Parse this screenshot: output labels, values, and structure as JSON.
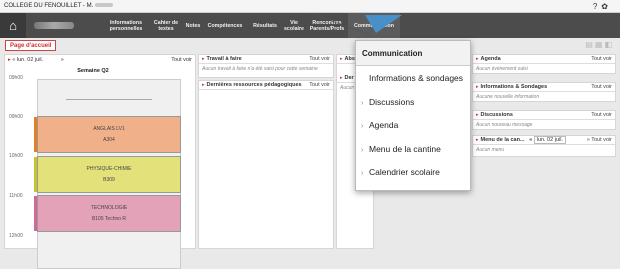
{
  "window": {
    "title": "COLLEGE DU FENOUILLET - M."
  },
  "nav": {
    "items": [
      {
        "label": "Informations personnelles"
      },
      {
        "label": "Cahier de textes"
      },
      {
        "label": "Notes"
      },
      {
        "label": "Compétences"
      },
      {
        "label": "Résultats"
      },
      {
        "label": "Vie scolaire"
      },
      {
        "label": "Rencontres Parents/Profs"
      },
      {
        "label": "Communication"
      }
    ]
  },
  "page_tab": "Page d'accueil",
  "agenda": {
    "nav_date": "lun. 02 juil.",
    "more": "Tout voir",
    "week": "Semaine Q2",
    "hours": [
      "09h00",
      "10h00",
      "11h00",
      "12h00"
    ],
    "hours_b": [
      "09h00",
      "10h00",
      "11h00",
      "12h00"
    ],
    "courses": [
      {
        "name": "ANGLAIS LV1",
        "room": "A304",
        "color": "#f0b08a",
        "bar": "#e67e22"
      },
      {
        "name": "PHYSIQUE-CHIMIE",
        "room": "B309",
        "color": "#e3e27a",
        "bar": "#c8c430"
      },
      {
        "name": "TECHNOLOGIE",
        "room": "B105 Techno R",
        "color": "#e3a2b8",
        "bar": "#d2679a"
      }
    ]
  },
  "travail": {
    "title": "Travail à faire",
    "more": "Tout voir",
    "empty": "Aucun travail à faire n'a été saisi pour cette semaine"
  },
  "ressources": {
    "title": "Dernières ressources pédagogiques",
    "more": "Tout voir"
  },
  "abs": {
    "title": "Abs",
    "label2": "Der",
    "text": "Aucun"
  },
  "right": {
    "agenda": {
      "title": "Agenda",
      "more": "Tout voir",
      "empty": "Aucun évènement saisi"
    },
    "infos": {
      "title": "Informations & Sondages",
      "more": "Tout voir",
      "empty": "Aucune nouvelle information"
    },
    "discussions": {
      "title": "Discussions",
      "more": "Tout voir",
      "empty": "Aucun nouveau message"
    },
    "menu": {
      "title": "Menu de la can...",
      "date": "lun. 02 juil.",
      "more": "Tout voir",
      "empty": "Aucun menu"
    }
  },
  "dropdown": {
    "title": "Communication",
    "items": [
      {
        "label": "Informations & sondages"
      },
      {
        "label": "Discussions"
      },
      {
        "label": "Agenda"
      },
      {
        "label": "Menu de la cantine"
      },
      {
        "label": "Calendrier scolaire"
      }
    ]
  }
}
